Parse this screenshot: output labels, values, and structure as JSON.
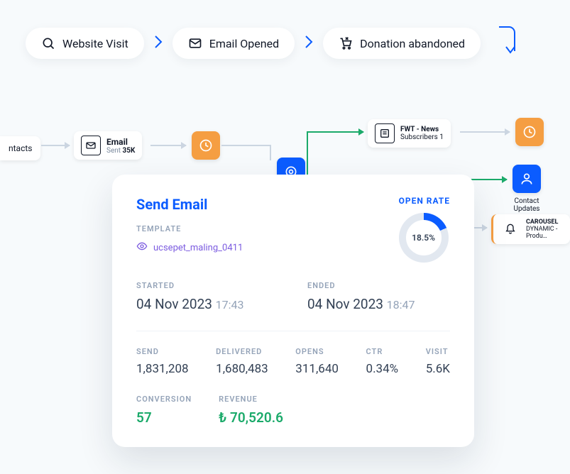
{
  "crumbs": {
    "visit": "Website Visit",
    "opened": "Email Opened",
    "abandoned": "Donation abandoned"
  },
  "nodes": {
    "contacts": "ntacts",
    "email_title": "Email",
    "email_sub_a": "Sent ",
    "email_sub_b": "35K",
    "fwt_a": "FWT - News",
    "fwt_b": "Subscribers 1",
    "contact_updates": "Contact Updates",
    "carousel_a": "CAROUSEL",
    "carousel_b": "DYNAMIC - Produ…"
  },
  "card": {
    "title": "Send Email",
    "template_label": "TEMPLATE",
    "template_name": "ucsepet_maling_0411",
    "openrate_label": "OPEN RATE",
    "openrate_value": "18.5%",
    "started_label": "STARTED",
    "started_date": "04 Nov 2023",
    "started_time": "17:43",
    "ended_label": "ENDED",
    "ended_date": "04 Nov 2023",
    "ended_time": "18:47",
    "metrics": {
      "send_k": "SEND",
      "send_v": "1,831,208",
      "delivered_k": "DELIVERED",
      "delivered_v": "1,680,483",
      "opens_k": "OPENS",
      "opens_v": "311,640",
      "ctr_k": "CTR",
      "ctr_v": "0.34%",
      "visit_k": "VISIT",
      "visit_v": "5.6K",
      "conversion_k": "CONVERSION",
      "conversion_v": "57",
      "revenue_k": "REVENUE",
      "revenue_v": "₺ 70,520.6"
    }
  }
}
